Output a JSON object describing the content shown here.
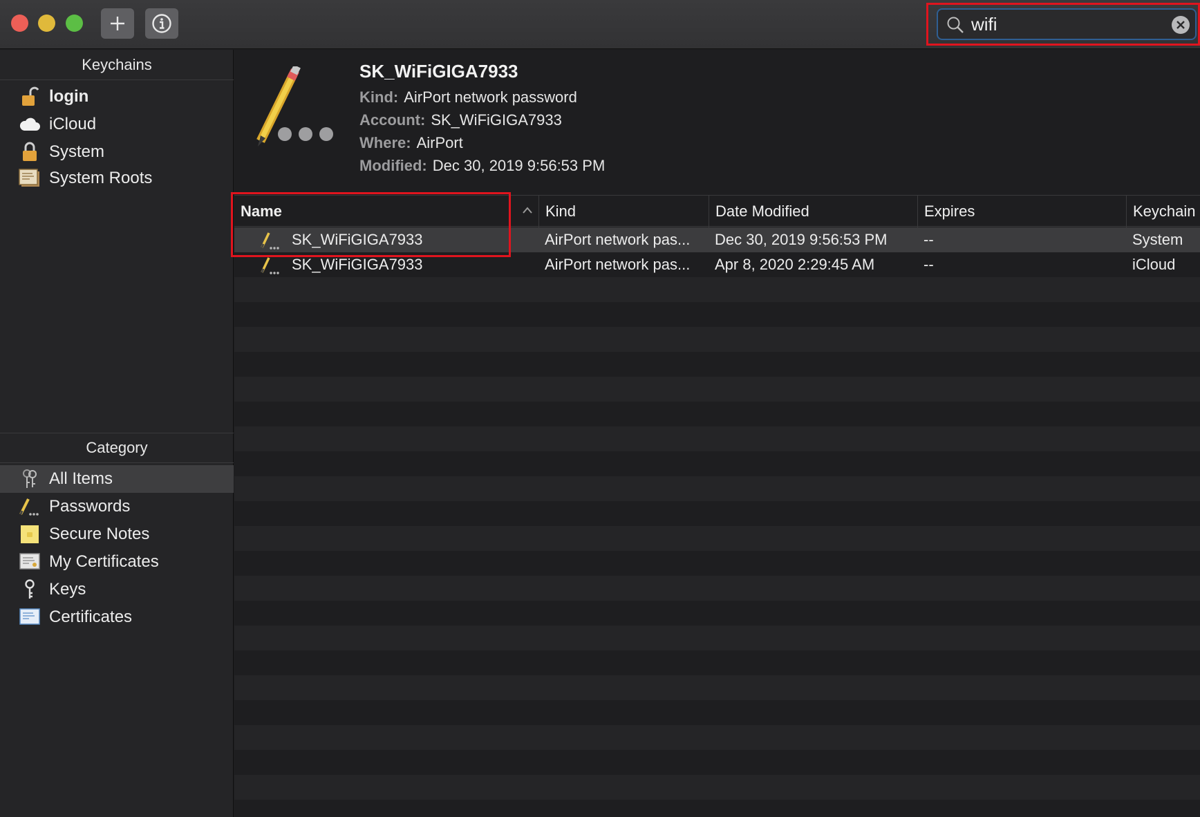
{
  "toolbar": {
    "add_icon": "plus-icon",
    "info_icon": "info-icon"
  },
  "search": {
    "value": "wifi",
    "icon": "magnifier-icon",
    "clear_icon": "clear-icon"
  },
  "sidebar": {
    "keychains_header": "Keychains",
    "keychains": [
      {
        "label": "login",
        "icon": "unlocked-padlock-icon"
      },
      {
        "label": "iCloud",
        "icon": "cloud-icon"
      },
      {
        "label": "System",
        "icon": "padlock-icon"
      },
      {
        "label": "System Roots",
        "icon": "certificate-icon"
      }
    ],
    "category_header": "Category",
    "categories": [
      {
        "label": "All Items",
        "icon": "keys-icon"
      },
      {
        "label": "Passwords",
        "icon": "pencil-icon"
      },
      {
        "label": "Secure Notes",
        "icon": "note-icon"
      },
      {
        "label": "My Certificates",
        "icon": "certificate-icon"
      },
      {
        "label": "Keys",
        "icon": "key-icon"
      },
      {
        "label": "Certificates",
        "icon": "certificate-icon"
      }
    ]
  },
  "detail": {
    "title": "SK_WiFiGIGA7933",
    "kind_label": "Kind:",
    "kind": "AirPort network password",
    "account_label": "Account:",
    "account": "SK_WiFiGIGA7933",
    "where_label": "Where:",
    "where": "AirPort",
    "modified_label": "Modified:",
    "modified": "Dec 30, 2019 9:56:53 PM"
  },
  "table": {
    "columns": [
      "Name",
      "Kind",
      "Date Modified",
      "Expires",
      "Keychain"
    ],
    "rows": [
      {
        "name": "SK_WiFiGIGA7933",
        "kind": "AirPort network pas...",
        "date": "Dec 30, 2019 9:56:53 PM",
        "expires": "--",
        "keychain": "System"
      },
      {
        "name": "SK_WiFiGIGA7933",
        "kind": "AirPort network pas...",
        "date": "Apr 8, 2020 2:29:45 AM",
        "expires": "--",
        "keychain": "iCloud"
      }
    ]
  },
  "colors": {
    "highlight": "#e0141e",
    "selection": "#3c3c3e"
  }
}
